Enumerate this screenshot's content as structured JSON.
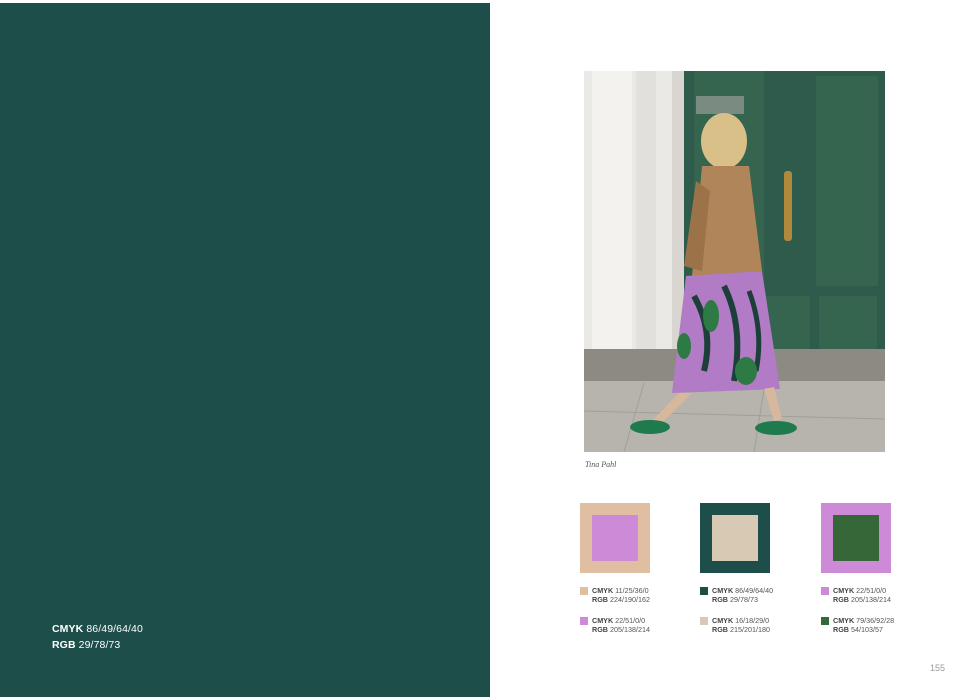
{
  "left_panel": {
    "color": "#1d4e49",
    "cmyk_label": "CMYK",
    "cmyk_value": "86/49/64/40",
    "rgb_label": "RGB",
    "rgb_value": "29/78/73"
  },
  "photo": {
    "caption": "Tina Pahl"
  },
  "swatches": [
    {
      "outer": "#e0bea2",
      "inner": "#cd8ad6"
    },
    {
      "outer": "#1d4e49",
      "inner": "#d7c9b4"
    },
    {
      "outer": "#cd8ad6",
      "inner": "#366739"
    }
  ],
  "codes": [
    {
      "chip": "#e0bea2",
      "cmyk": "11/25/36/0",
      "rgb": "224/190/162"
    },
    {
      "chip": "#1d4e49",
      "cmyk": "86/49/64/40",
      "rgb": "29/78/73"
    },
    {
      "chip": "#cd8ad6",
      "cmyk": "22/51/0/0",
      "rgb": "205/138/214"
    },
    {
      "chip": "#cd8ad6",
      "cmyk": "22/51/0/0",
      "rgb": "205/138/214"
    },
    {
      "chip": "#d7c9b4",
      "cmyk": "16/18/29/0",
      "rgb": "215/201/180"
    },
    {
      "chip": "#366739",
      "cmyk": "79/36/92/28",
      "rgb": "54/103/57"
    }
  ],
  "labels": {
    "cmyk": "CMYK",
    "rgb": "RGB"
  },
  "page_number": "155"
}
